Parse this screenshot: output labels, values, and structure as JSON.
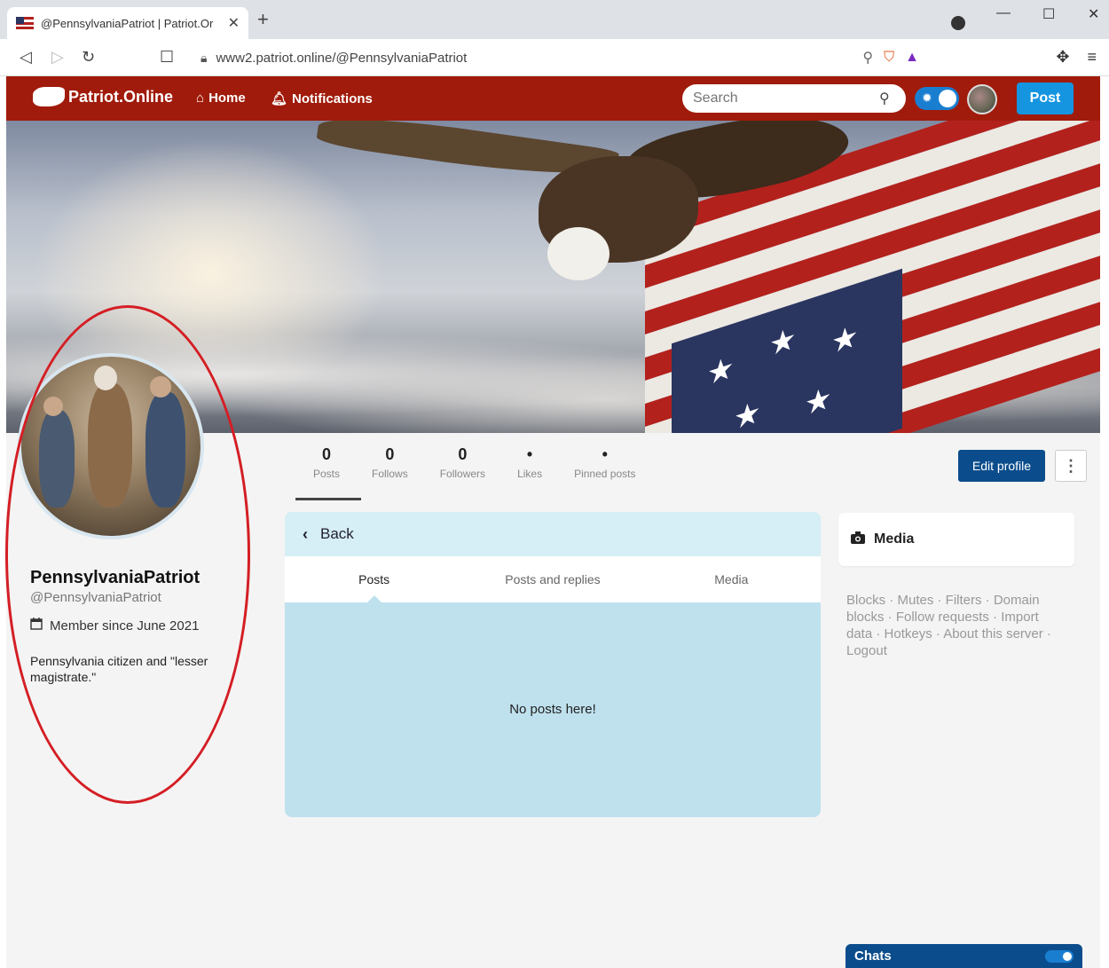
{
  "browser": {
    "tab_title": "@PennsylvaniaPatriot | Patriot.Or",
    "url": "www2.patriot.online/@PennsylvaniaPatriot"
  },
  "nav": {
    "logo_text": "Patriot.Online",
    "home_label": "Home",
    "notifications_label": "Notifications",
    "search_placeholder": "Search",
    "post_label": "Post"
  },
  "profile": {
    "display_name": "PennsylvaniaPatriot",
    "handle": "@PennsylvaniaPatriot",
    "member_since": "Member since June 2021",
    "bio": "Pennsylvania citizen and \"lesser magistrate.\""
  },
  "stats": [
    {
      "value": "0",
      "label": "Posts"
    },
    {
      "value": "0",
      "label": "Follows"
    },
    {
      "value": "0",
      "label": "Followers"
    },
    {
      "value": "•",
      "label": "Likes"
    },
    {
      "value": "•",
      "label": "Pinned posts"
    }
  ],
  "actions": {
    "edit_profile": "Edit profile"
  },
  "feed": {
    "back_label": "Back",
    "tabs": [
      "Posts",
      "Posts and replies",
      "Media"
    ],
    "empty_message": "No posts here!"
  },
  "sidebar": {
    "media_label": "Media",
    "footer_links": "Blocks · Mutes · Filters · Domain blocks · Follow requests · Import data · Hotkeys · About this server · Logout"
  },
  "chats": {
    "label": "Chats"
  },
  "colors": {
    "nav_bg": "#a01b0b",
    "accent": "#1595e0",
    "primary_dark": "#0b4d8c",
    "feed_bg": "#bfe1ee",
    "annotation_red": "#d41e24"
  }
}
